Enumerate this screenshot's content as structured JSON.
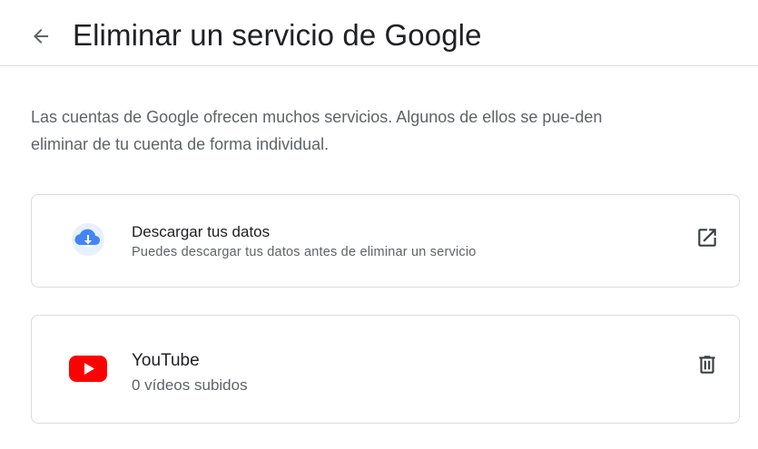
{
  "header": {
    "back_icon": "arrow-back-icon",
    "title": "Eliminar un servicio de Google"
  },
  "intro": {
    "text": "Las cuentas de Google ofrecen muchos servicios. Algunos de ellos se pue-den eliminar de tu cuenta de forma individual."
  },
  "services": [
    {
      "icon": "cloud-download-icon",
      "title": "Descargar tus datos",
      "subtitle": "Puedes descargar tus datos antes de eliminar un servicio",
      "action_icon": "open-in-new-icon"
    },
    {
      "icon": "youtube-icon",
      "title": "YouTube",
      "subtitle": "0 vídeos subidos",
      "action_icon": "trash-icon"
    }
  ],
  "colors": {
    "youtube_red": "#ff0000",
    "cloud_blue": "#4285f4",
    "divider": "#dadce0",
    "secondary_text": "#5f6368"
  }
}
